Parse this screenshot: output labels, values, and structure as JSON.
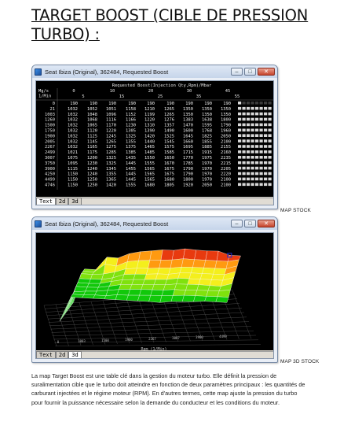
{
  "heading": "TARGET BOOST (CIBLE DE PRESSION TURBO) :",
  "window1": {
    "title": "Seat Ibiza (Original), 362484, Requested Boost",
    "map_title": "Requested Boost(Injection Qty,Rpm)/Mbar",
    "corner_label": "Mg/s\n1/Min",
    "col_headers_top": [
      "0",
      "10",
      "20",
      "30",
      "45"
    ],
    "col_headers_bottom": [
      "5",
      "15",
      "25",
      "35",
      "55"
    ],
    "rows": [
      {
        "rpm": "0",
        "vals": [
          "190",
          "190",
          "190",
          "190",
          "190",
          "190",
          "190",
          "190",
          "190"
        ]
      },
      {
        "rpm": "21",
        "vals": [
          "1032",
          "1052",
          "1051",
          "1158",
          "1210",
          "1265",
          "1350",
          "1350",
          "1350"
        ]
      },
      {
        "rpm": "1003",
        "vals": [
          "1032",
          "1048",
          "1096",
          "1152",
          "1199",
          "1265",
          "1350",
          "1350",
          "1350"
        ]
      },
      {
        "rpm": "1260",
        "vals": [
          "1032",
          "1068",
          "1116",
          "1166",
          "1220",
          "1276",
          "1383",
          "1638",
          "1800"
        ]
      },
      {
        "rpm": "1500",
        "vals": [
          "1032",
          "1065",
          "1170",
          "1230",
          "1310",
          "1357",
          "1470",
          "1595",
          "1790"
        ]
      },
      {
        "rpm": "1750",
        "vals": [
          "1032",
          "1120",
          "1220",
          "1305",
          "1390",
          "1490",
          "1600",
          "1768",
          "1960"
        ]
      },
      {
        "rpm": "1900",
        "vals": [
          "1032",
          "1125",
          "1245",
          "1325",
          "1420",
          "1525",
          "1645",
          "1825",
          "2050"
        ]
      },
      {
        "rpm": "2005",
        "vals": [
          "1032",
          "1145",
          "1265",
          "1355",
          "1440",
          "1545",
          "1660",
          "1855",
          "2100"
        ]
      },
      {
        "rpm": "2267",
        "vals": [
          "1032",
          "1165",
          "1275",
          "1375",
          "1465",
          "1575",
          "1695",
          "1885",
          "2155"
        ]
      },
      {
        "rpm": "2499",
        "vals": [
          "1021",
          "1175",
          "1285",
          "1385",
          "1485",
          "1585",
          "1715",
          "1915",
          "2160"
        ]
      },
      {
        "rpm": "3007",
        "vals": [
          "1075",
          "1200",
          "1325",
          "1435",
          "1550",
          "1650",
          "1770",
          "1975",
          "2235"
        ]
      },
      {
        "rpm": "3750",
        "vals": [
          "1095",
          "1230",
          "1325",
          "1445",
          "1555",
          "1670",
          "1785",
          "1970",
          "2215"
        ]
      },
      {
        "rpm": "3900",
        "vals": [
          "1115",
          "1240",
          "1345",
          "1455",
          "1565",
          "1675",
          "1790",
          "1970",
          "2205"
        ]
      },
      {
        "rpm": "4250",
        "vals": [
          "1150",
          "1240",
          "1355",
          "1445",
          "1565",
          "1675",
          "1790",
          "1970",
          "2220"
        ]
      },
      {
        "rpm": "4499",
        "vals": [
          "1150",
          "1250",
          "1365",
          "1445",
          "1565",
          "1680",
          "1800",
          "1970",
          "2100"
        ]
      },
      {
        "rpm": "4746",
        "vals": [
          "1150",
          "1250",
          "1420",
          "1555",
          "1680",
          "1805",
          "1920",
          "2050",
          "2100"
        ]
      }
    ],
    "tabs": [
      "Text",
      "2d",
      "3d"
    ],
    "active_tab": "Text"
  },
  "caption1": "MAP STOCK",
  "window2": {
    "title": "Seat Ibiza (Original), 362484, Requested Boost",
    "xaxis_label": "Rpm (1/Min)",
    "tabs": [
      "Text",
      "2d",
      "3d"
    ],
    "active_tab": "3d",
    "surface_colors": [
      "#11c80a",
      "#7fe20d",
      "#f4ef1c",
      "#ff9a10",
      "#e83a0f"
    ]
  },
  "caption2": "MAP 3D STOCK",
  "body": "La map Target Boost est une table clé dans la gestion du moteur turbo. Elle définit la pression de suralimentation cible que le turbo doit atteindre en fonction de deux paramètres principaux : les quantités de carburant injectées et le régime moteur (RPM). En d'autres termes, cette map ajuste la pression du turbo pour fournir la puissance nécessaire selon la demande du conducteur et les conditions du moteur."
}
